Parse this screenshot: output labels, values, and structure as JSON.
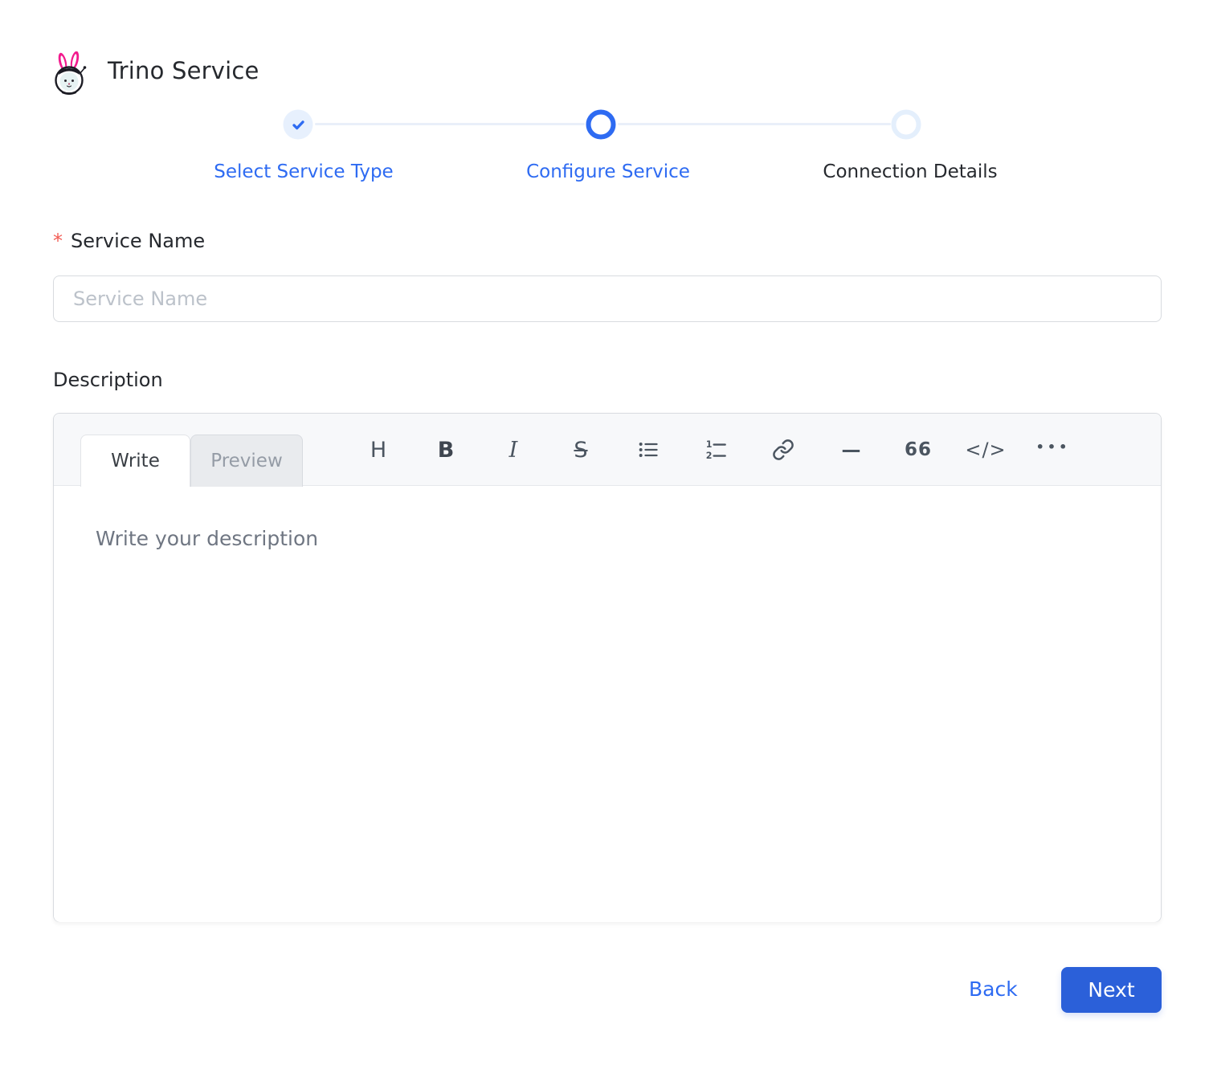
{
  "header": {
    "title": "Trino Service",
    "logo_icon": "trino-bunny-logo"
  },
  "stepper": {
    "steps": [
      {
        "label": "Select Service Type",
        "state": "completed",
        "icon": "check-icon"
      },
      {
        "label": "Configure Service",
        "state": "active"
      },
      {
        "label": "Connection Details",
        "state": "upcoming"
      }
    ]
  },
  "form": {
    "service_name": {
      "required_marker": "*",
      "label": "Service Name",
      "placeholder": "Service Name",
      "value": ""
    },
    "description": {
      "label": "Description"
    }
  },
  "editor": {
    "tabs": [
      {
        "label": "Write",
        "active": true
      },
      {
        "label": "Preview",
        "active": false
      }
    ],
    "placeholder": "Write your description",
    "value": "",
    "toolbar": {
      "heading_glyph": "H",
      "bold_glyph": "B",
      "italic_glyph": "I",
      "strike_glyph": "S",
      "hr_glyph": "—",
      "quote_glyph": "66",
      "code_glyph": "</>",
      "more_glyph": "•••"
    },
    "toolbar_icon_names": [
      "heading-icon",
      "bold-icon",
      "italic-icon",
      "strikethrough-icon",
      "bullet-list-icon",
      "numbered-list-icon",
      "link-icon",
      "horizontal-rule-icon",
      "quote-icon",
      "code-icon",
      "ellipsis-icon"
    ]
  },
  "footer": {
    "back_label": "Back",
    "next_label": "Next"
  },
  "colors": {
    "primary_blue": "#2e6bf2",
    "button_blue": "#2b60d9",
    "step_done_bg": "#e7f0fd",
    "step_upcoming_ring": "#e4effc",
    "connector": "#e9eff9",
    "toolbar_bg": "#f7f8fa",
    "border": "#d8dbe0",
    "required_red": "#f25c54",
    "placeholder_gray": "#bcc2ca",
    "editor_placeholder_gray": "#6f7682"
  }
}
